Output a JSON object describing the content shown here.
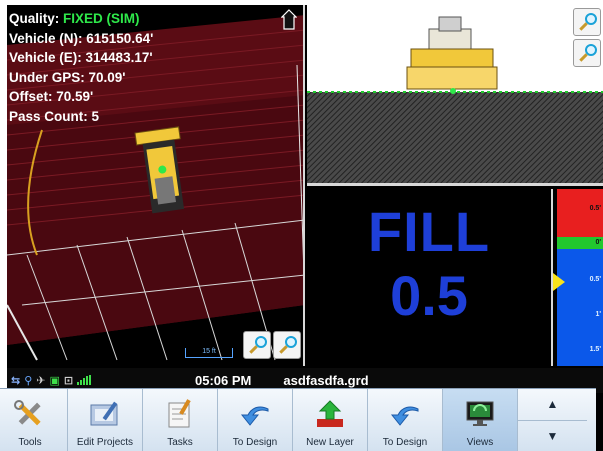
{
  "plan_view": {
    "quality_label": "Quality:",
    "quality_value": "FIXED (SIM)",
    "vehicle_n": "Vehicle (N): 615150.64'",
    "vehicle_e": "Vehicle (E): 314483.17'",
    "under_gps": "Under GPS: 70.09'",
    "offset": "Offset: 70.59'",
    "pass_count": "Pass Count: 5",
    "scale_label": "15 ft",
    "icons": [
      "home-icon",
      "zoom-in-icon",
      "zoom-out-icon",
      "dozer-icon"
    ]
  },
  "profile_view": {
    "icons": [
      "zoom-in-icon",
      "zoom-out-icon",
      "dozer-front-icon"
    ]
  },
  "cut_fill": {
    "label": "FILL",
    "value": "0.5",
    "color": "#1e3fd8"
  },
  "grade_indicator": {
    "cut_label": "0.5'",
    "on_grade_label": "0'",
    "fill_label_1": "0.5'",
    "fill_label_2": "1'",
    "fill_label_3": "1.5'",
    "colors": {
      "cut": "#e81f1f",
      "on_grade": "#22c82e",
      "fill": "#0b58ea",
      "marker": "#f8e21c"
    }
  },
  "status_bar": {
    "time": "05:06 PM",
    "file": "asdfasdfa.grd",
    "icons": [
      "network-icon",
      "antenna-icon",
      "satellite-icon",
      "gps-icon",
      "radio-icon",
      "signal-icon"
    ]
  },
  "toolbar": {
    "buttons": [
      {
        "label": "Tools",
        "icon": "tools-icon"
      },
      {
        "label": "Edit Projects",
        "icon": "edit-projects-icon"
      },
      {
        "label": "Tasks",
        "icon": "tasks-icon"
      },
      {
        "label": "To Design",
        "icon": "to-design-icon"
      },
      {
        "label": "New Layer",
        "icon": "new-layer-icon"
      },
      {
        "label": "To Design",
        "icon": "to-design-icon"
      },
      {
        "label": "Views",
        "icon": "views-icon"
      }
    ],
    "scroll_up": "▲",
    "scroll_down": "▼"
  }
}
